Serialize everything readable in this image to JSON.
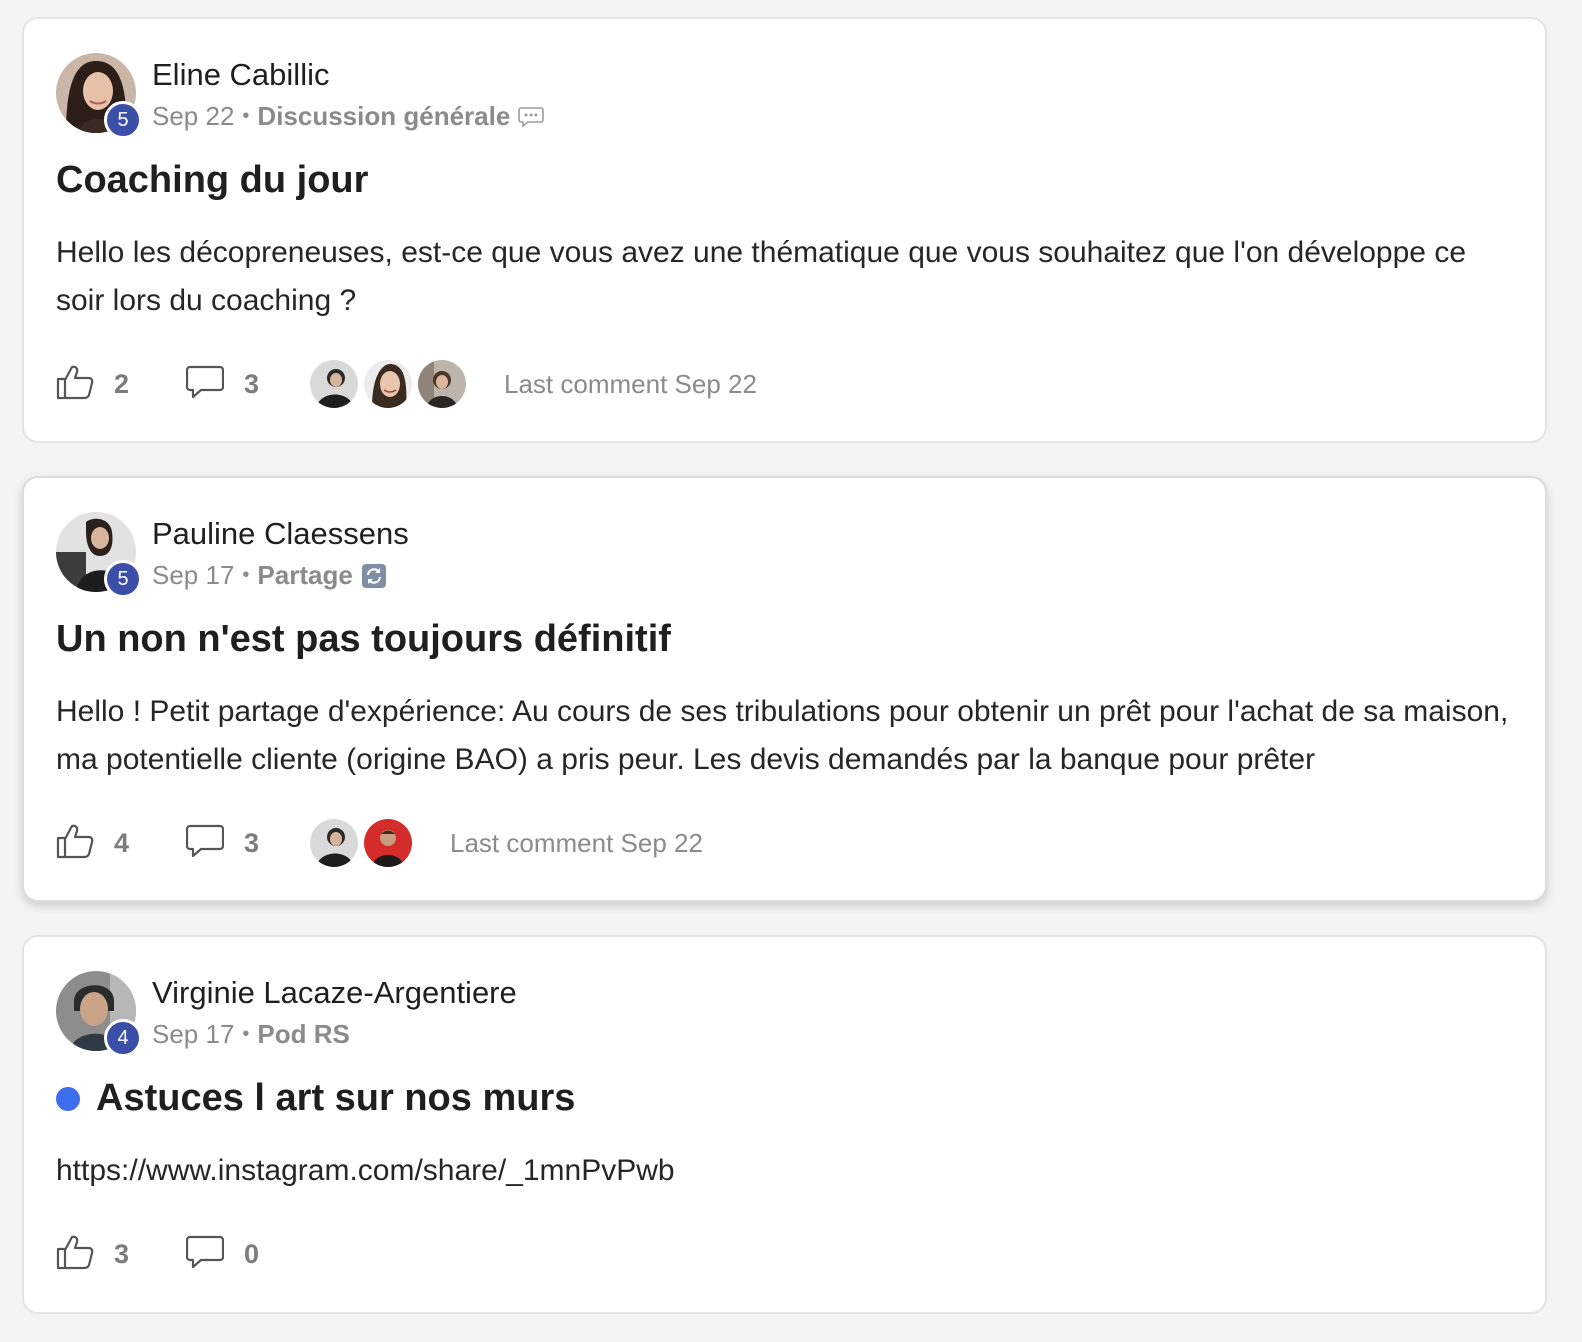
{
  "posts": [
    {
      "author": "Eline Cabillic",
      "level": "5",
      "date": "Sep 22",
      "separator": "•",
      "category": "Discussion générale",
      "category_icon": "speech-bubble-icon",
      "title": "Coaching du jour",
      "body": "Hello les décopreneuses, est-ce que vous avez une thématique que vous souhaitez que l'on développe ce soir lors du coaching ?",
      "likes": "2",
      "comments": "3",
      "commenter_count": 3,
      "last_comment": "Last comment Sep 22"
    },
    {
      "author": "Pauline Claessens",
      "level": "5",
      "date": "Sep 17",
      "separator": "•",
      "category": "Partage",
      "category_icon": "refresh-arrows-icon",
      "title": "Un non n'est pas toujours définitif",
      "body": "Hello ! Petit partage d'expérience: Au cours de ses tribulations pour obtenir un prêt pour l'achat de sa maison, ma potentielle cliente (origine BAO) a pris peur. Les devis demandés par la banque pour prêter",
      "likes": "4",
      "comments": "3",
      "commenter_count": 2,
      "last_comment": "Last comment Sep 22"
    },
    {
      "author": "Virginie Lacaze-Argentiere",
      "level": "4",
      "date": "Sep 17",
      "separator": "•",
      "category": "Pod RS",
      "title": "Astuces l art sur nos murs",
      "unread": true,
      "body": "https://www.instagram.com/share/_1mnPvPwb",
      "likes": "3",
      "comments": "0"
    }
  ],
  "colors": {
    "level_badge": "#3b4ea8",
    "unread_dot": "#3f6df0",
    "background": "#f4f4f3",
    "meta_text": "#8b8b8b"
  }
}
